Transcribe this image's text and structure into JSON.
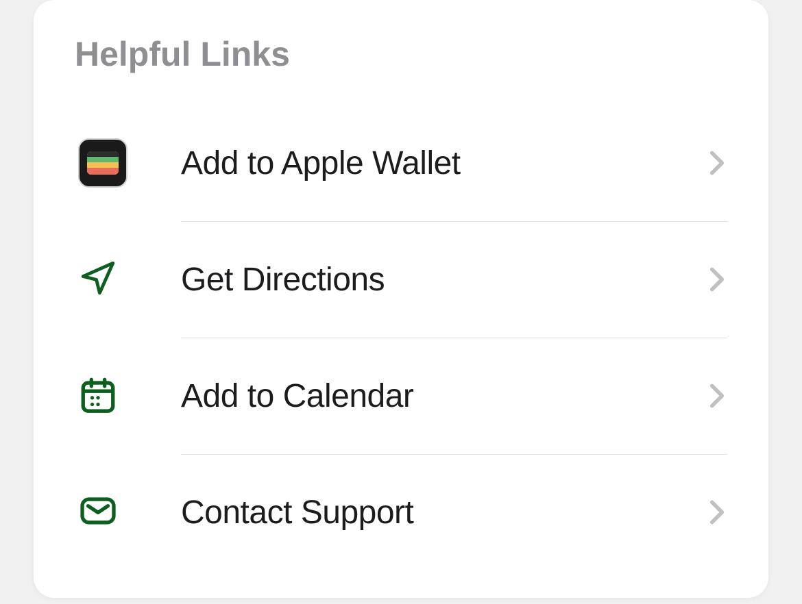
{
  "section": {
    "title": "Helpful Links",
    "items": [
      {
        "label": "Add to Apple Wallet",
        "icon": "wallet-icon"
      },
      {
        "label": "Get Directions",
        "icon": "navigation-arrow-icon"
      },
      {
        "label": "Add to Calendar",
        "icon": "calendar-icon"
      },
      {
        "label": "Contact Support",
        "icon": "mail-icon"
      }
    ]
  },
  "colors": {
    "accent_green": "#0d5e1f",
    "label_gray": "#8e8e93",
    "chevron_gray": "#b8b8b8"
  }
}
